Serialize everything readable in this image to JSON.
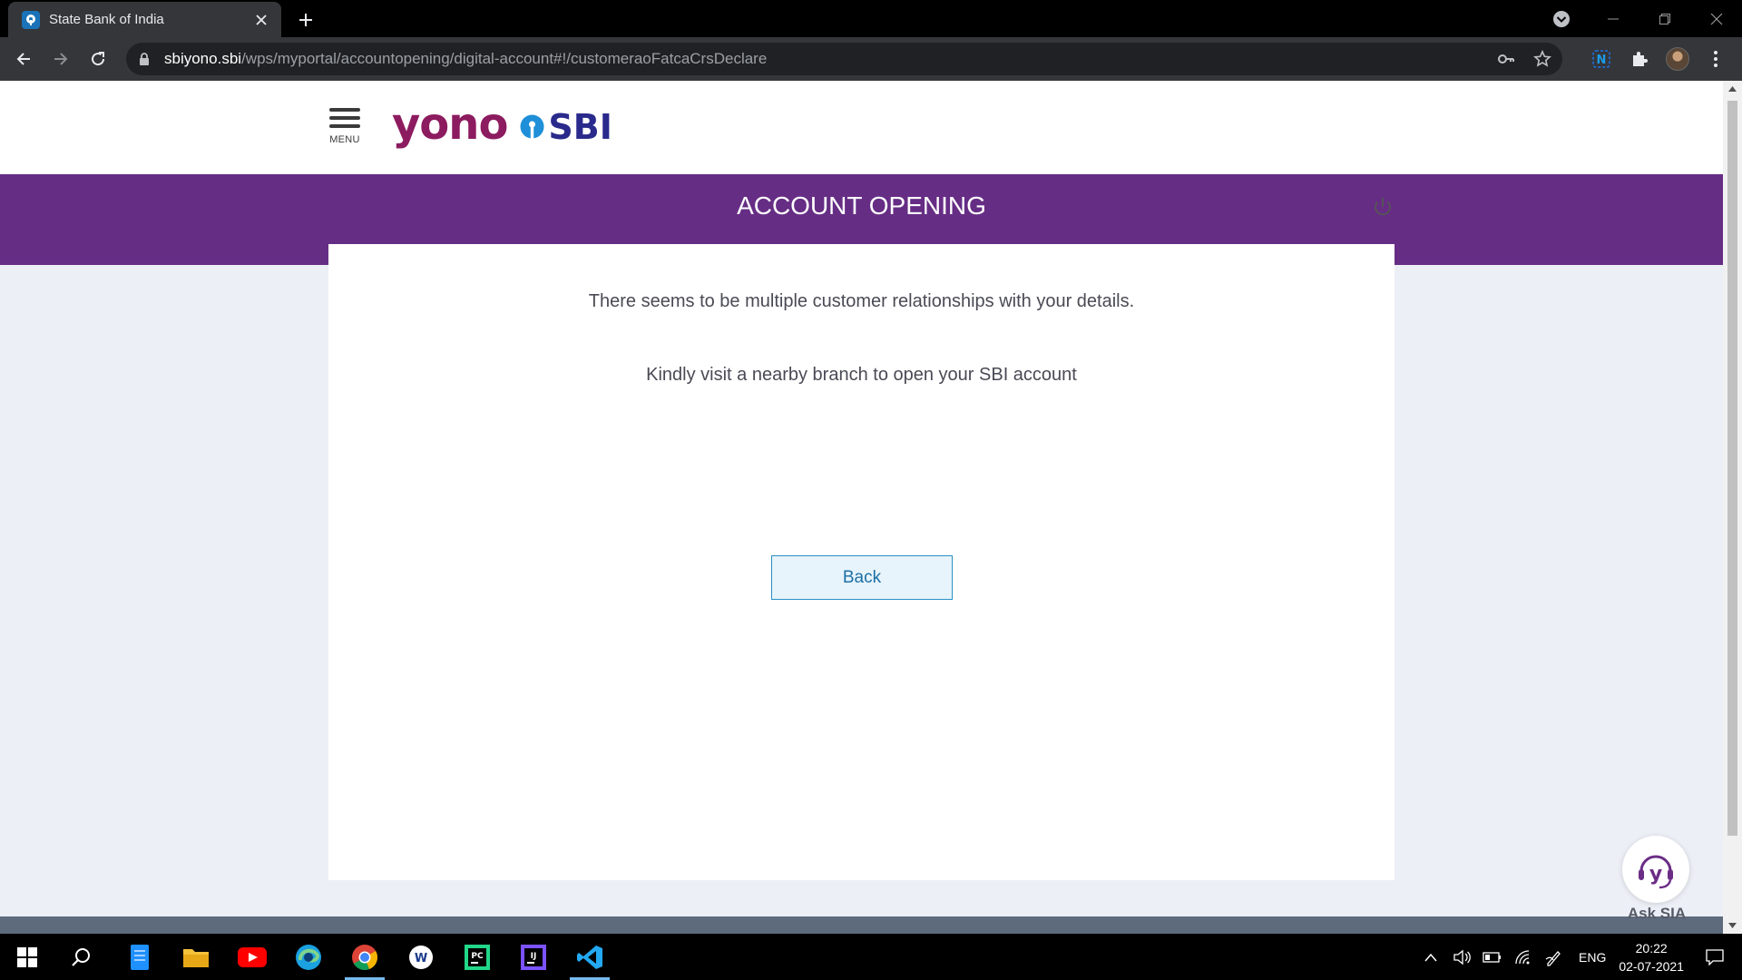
{
  "browser": {
    "tab_title": "State Bank of India",
    "url_host": "sbiyono.sbi",
    "url_path": "/wps/myportal/accountopening/digital-account#!/customeraoFatcaCrsDeclare"
  },
  "header": {
    "menu_label": "MENU",
    "logo_primary": "yono",
    "logo_secondary": "SBI"
  },
  "banner": {
    "title": "ACCOUNT OPENING"
  },
  "card": {
    "message_1": "There seems to be multiple customer relationships with your details.",
    "message_2": "Kindly visit a nearby branch to open your SBI account",
    "back_label": "Back"
  },
  "assistant": {
    "label": "Ask SIA"
  },
  "taskbar": {
    "language": "ENG",
    "time": "20:22",
    "date": "02-07-2021"
  },
  "colors": {
    "banner": "#662d85",
    "logo_yono": "#8c1b5f",
    "logo_sbi": "#2a2a8c",
    "button_border": "#2a8fc4"
  }
}
